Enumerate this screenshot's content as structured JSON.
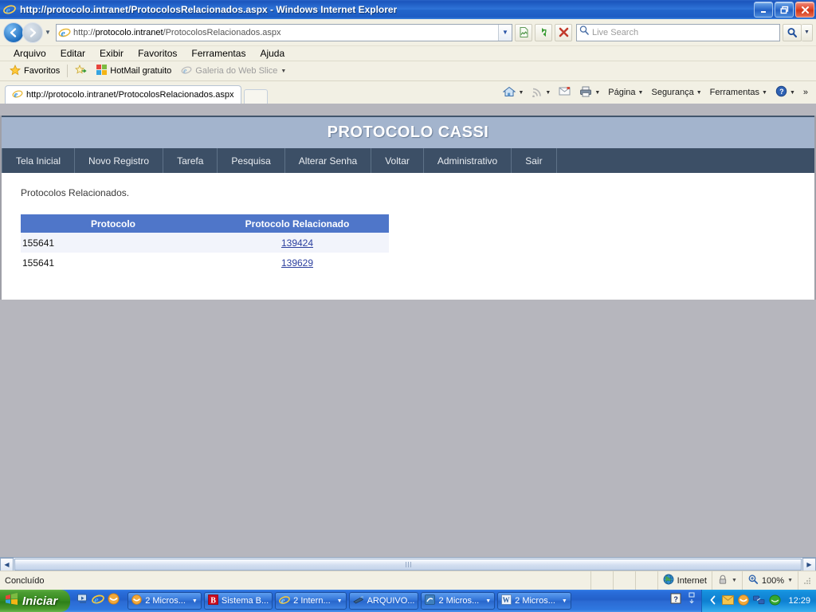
{
  "window": {
    "title": "http://protocolo.intranet/ProtocolosRelacionados.aspx - Windows Internet Explorer",
    "minimize_label": "Minimizar",
    "maximize_label": "Restaurar",
    "close_label": "Fechar"
  },
  "browser": {
    "back_label": "Voltar",
    "forward_label": "Avançar",
    "address": {
      "protocol": "http://",
      "host": "protocolo.intranet",
      "path": "/ProtocolosRelacionados.aspx",
      "full": "http://protocolo.intranet/ProtocolosRelacionados.aspx"
    },
    "toolbar_buttons": [
      {
        "name": "compatibility-view",
        "label": "Modo de Exibição de Compatibilidade"
      },
      {
        "name": "refresh",
        "label": "Atualizar"
      },
      {
        "name": "stop",
        "label": "Parar"
      }
    ],
    "search": {
      "placeholder": "Live Search",
      "value": "",
      "go_label": "Pesquisar"
    },
    "menu": [
      {
        "label": "Arquivo"
      },
      {
        "label": "Editar"
      },
      {
        "label": "Exibir"
      },
      {
        "label": "Favoritos"
      },
      {
        "label": "Ferramentas"
      },
      {
        "label": "Ajuda"
      }
    ],
    "favorites_bar": {
      "favorites_label": "Favoritos",
      "items": [
        {
          "label": "HotMail gratuito",
          "dim": false
        },
        {
          "label": "Galeria do Web Slice",
          "dim": true
        }
      ]
    },
    "tabs": [
      {
        "label": "http://protocolo.intranet/ProtocolosRelacionados.aspx",
        "active": true
      }
    ],
    "command_bar": [
      {
        "label": "Página"
      },
      {
        "label": "Segurança"
      },
      {
        "label": "Ferramentas"
      }
    ],
    "overflow_label": "»"
  },
  "page": {
    "banner_title": "PROTOCOLO CASSI",
    "nav": [
      {
        "label": "Tela Inicial"
      },
      {
        "label": "Novo Registro"
      },
      {
        "label": "Tarefa"
      },
      {
        "label": "Pesquisa"
      },
      {
        "label": "Alterar Senha"
      },
      {
        "label": "Voltar"
      },
      {
        "label": "Administrativo"
      },
      {
        "label": "Sair"
      }
    ],
    "lead_text": "Protocolos Relacionados.",
    "table": {
      "columns": [
        "Protocolo",
        "Protocolo Relacionado"
      ],
      "rows": [
        {
          "protocolo": "155641",
          "relacionado": "139424"
        },
        {
          "protocolo": "155641",
          "relacionado": "139629"
        }
      ]
    }
  },
  "status_bar": {
    "message": "Concluído",
    "zone": "Internet",
    "zoom": "100%"
  },
  "taskbar": {
    "start_label": "Iniciar",
    "buttons": [
      {
        "label": "2 Micros...",
        "icon": "outlook-icon",
        "has_dropdown": true
      },
      {
        "label": "Sistema B...",
        "icon": "bradesco-icon",
        "has_dropdown": false
      },
      {
        "label": "2 Intern...",
        "icon": "ie-icon",
        "has_dropdown": true
      },
      {
        "label": "ARQUIVO...",
        "icon": "pen-icon",
        "has_dropdown": false
      },
      {
        "label": "2 Micros...",
        "icon": "excel-icon",
        "has_dropdown": true
      },
      {
        "label": "2 Micros...",
        "icon": "word-icon",
        "has_dropdown": true
      }
    ],
    "clock": "12:29"
  },
  "colors": {
    "title_blue": "#2a64c8",
    "banner_blue": "#a3b4cd",
    "nav_dark": "#3c4f66",
    "table_header": "#4f76c9",
    "link_blue": "#2b3f9e",
    "alt_row": "#f2f4fb",
    "desktop_gray": "#b6b6bd"
  }
}
